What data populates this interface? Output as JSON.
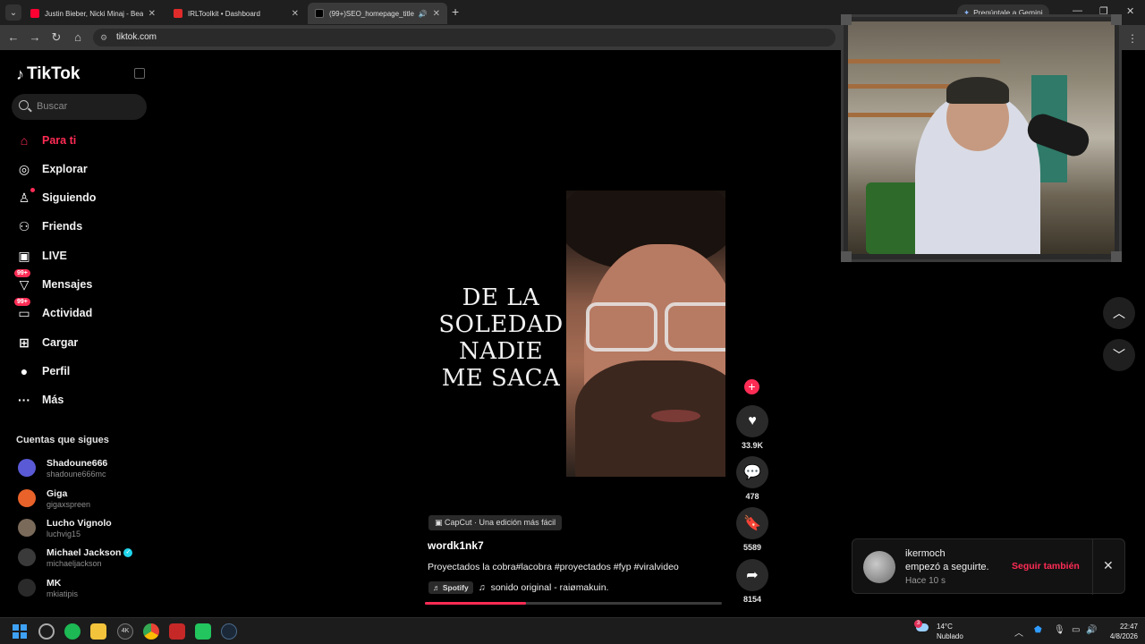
{
  "browser": {
    "tabs": [
      {
        "label": "Justin Bieber, Nicki Minaj - Beauty And A Beat",
        "favicon_color": "#ff0033"
      },
      {
        "label": "IRLToolkit • Dashboard",
        "favicon_color": "#e02b2b"
      },
      {
        "label": "(99+)SEO_homepage_title",
        "favicon_color": "#000000"
      }
    ],
    "gemini": "Pregúntale a Gemini",
    "url": "tiktok.com"
  },
  "tiktok": {
    "logo": "TikTok",
    "search_placeholder": "Buscar",
    "nav": [
      {
        "label": "Para ti",
        "icon": "home-icon",
        "active": true
      },
      {
        "label": "Explorar",
        "icon": "compass-icon"
      },
      {
        "label": "Siguiendo",
        "icon": "following-icon"
      },
      {
        "label": "Friends",
        "icon": "friends-icon"
      },
      {
        "label": "LIVE",
        "icon": "live-icon"
      },
      {
        "label": "Mensajes",
        "icon": "messages-icon",
        "badge": "99+"
      },
      {
        "label": "Actividad",
        "icon": "activity-icon",
        "badge": "99+"
      },
      {
        "label": "Cargar",
        "icon": "upload-icon"
      },
      {
        "label": "Perfil",
        "icon": "profile-icon"
      },
      {
        "label": "Más",
        "icon": "more-icon"
      }
    ],
    "following_title": "Cuentas que sigues",
    "following": [
      {
        "name": "Shadoune666",
        "handle": "shadoune666mc",
        "color": "#5a5ad6"
      },
      {
        "name": "Giga",
        "handle": "gigaxspreen",
        "color": "#e8622a"
      },
      {
        "name": "Lucho Vignolo",
        "handle": "luchvig15",
        "color": "#7a6a5a"
      },
      {
        "name": "Michael Jackson",
        "handle": "michaeljackson",
        "color": "#3a3a3a",
        "verified": true
      },
      {
        "name": "MK",
        "handle": "mkiatipis",
        "color": "#2a2a2a"
      }
    ],
    "video": {
      "overlay_text": [
        "DE LA",
        "SOLEDAD",
        "NADIE",
        "ME SACA"
      ],
      "capcut": "CapCut · Una edición más fácil",
      "author": "wordk1nk7",
      "description": "Proyectados la cobra#lacobra #proyectados #fyp #viralvideo",
      "spotify": "Spotify",
      "music": "sonido original - raiømakuin.",
      "progress": 0.34
    },
    "actions": {
      "likes": "33.9K",
      "comments": "478",
      "saves": "5589",
      "shares": "8154"
    },
    "notification": {
      "user": "ikermoch",
      "message": "empezó a seguirte.",
      "time": "Hace 10 s",
      "follow_back": "Seguir también"
    }
  },
  "taskbar": {
    "weather_temp": "14°C",
    "weather_desc": "Nublado",
    "weather_badge": "3",
    "time": "22:47",
    "date": "4/8/2026"
  }
}
